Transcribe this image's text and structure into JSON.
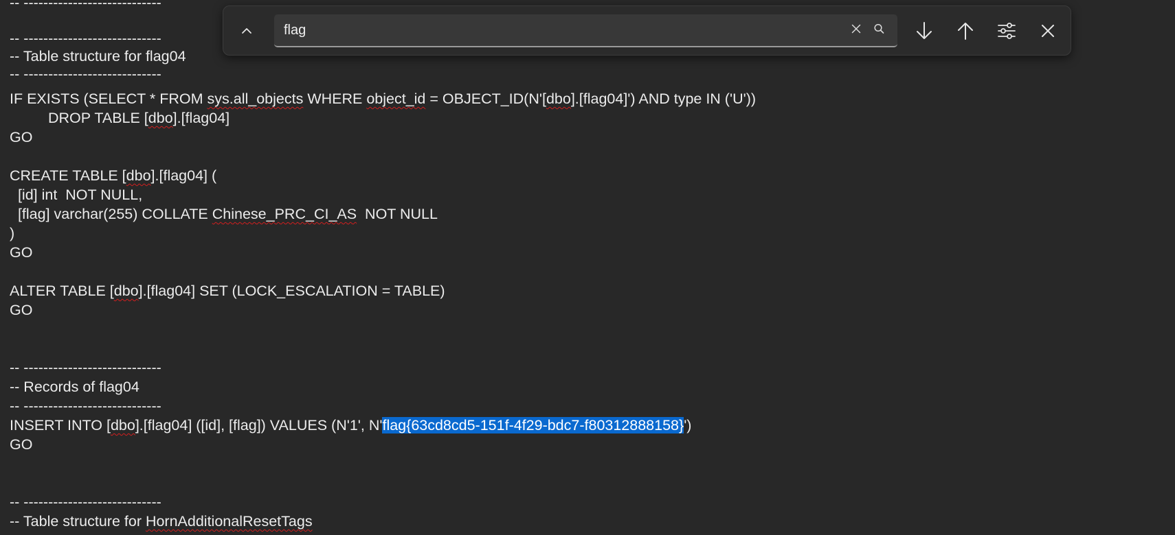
{
  "editor": {
    "lines": {
      "l0": [
        "-- ----------------------------"
      ],
      "l2": [
        "-- ----------------------------"
      ],
      "l3": [
        "-- Table structure for flag04"
      ],
      "l4": [
        "-- ----------------------------"
      ],
      "l5": [
        "IF EXISTS (SELECT * FROM ",
        "sys.all_objects",
        " WHERE ",
        "object_id",
        " = OBJECT_ID(N'[",
        "dbo",
        "].[flag04]') AND type IN ('U'))"
      ],
      "l6": [
        "\tDROP TABLE [",
        "dbo",
        "].[flag04]"
      ],
      "l7": [
        "GO"
      ],
      "l9": [
        "CREATE TABLE [",
        "dbo",
        "].[flag04] ("
      ],
      "l10": [
        "  [id] int  NOT NULL,"
      ],
      "l11": [
        "  [flag] varchar(255) COLLATE ",
        "Chinese_PRC_CI_AS",
        "  NOT NULL"
      ],
      "l12": [
        ")"
      ],
      "l13": [
        "GO"
      ],
      "l15": [
        "ALTER TABLE [",
        "dbo",
        "].[flag04] SET (LOCK_ESCALATION = TABLE)"
      ],
      "l16": [
        "GO"
      ],
      "l19": [
        "-- ----------------------------"
      ],
      "l20": [
        "-- Records of flag04"
      ],
      "l21": [
        "-- ----------------------------"
      ],
      "l22": [
        "INSERT INTO [",
        "dbo",
        "].[flag04] ([id], [flag]) VALUES (N'1', N'",
        "flag{63cd8cd5-151f-4f29-bdc7-f80312888158}",
        "')"
      ],
      "l23": [
        "GO"
      ],
      "l26": [
        "-- ----------------------------"
      ],
      "l27": [
        "-- Table structure for ",
        "HornAdditionalResetTags"
      ]
    }
  },
  "find": {
    "query": "flag",
    "collapse_icon": "chevron-up-icon",
    "clear_icon": "clear-x-icon",
    "search_icon": "magnifier-icon",
    "next_icon": "arrow-down-icon",
    "prev_icon": "arrow-up-icon",
    "options_icon": "sliders-icon",
    "close_icon": "close-icon"
  },
  "colors": {
    "background": "#282828",
    "text": "#ececec",
    "match_highlight": "#0a69cf",
    "spell_squiggle": "#d21f1f",
    "findbar_bg": "#2b2b2b"
  }
}
